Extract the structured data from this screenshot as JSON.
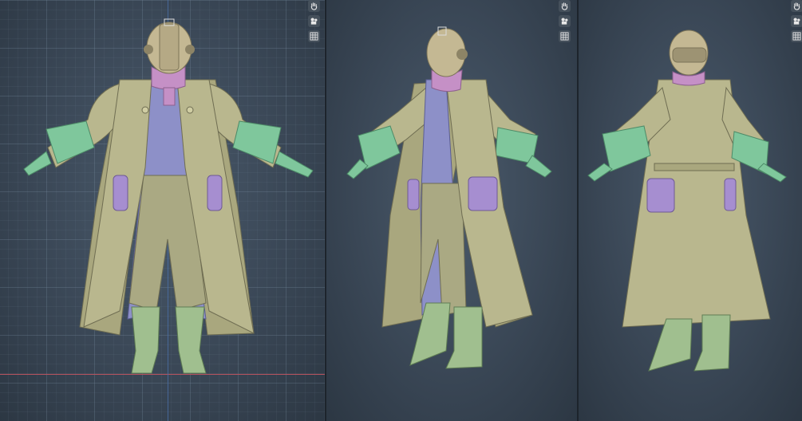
{
  "app": {
    "viewports": [
      {
        "id": "front",
        "tools": [
          "hand-pan-icon",
          "camera-orbit-icon",
          "grid-toggle-icon"
        ]
      },
      {
        "id": "perspective",
        "tools": [
          "hand-pan-icon",
          "camera-orbit-icon",
          "grid-toggle-icon"
        ]
      },
      {
        "id": "back",
        "tools": [
          "hand-pan-icon",
          "camera-orbit-icon",
          "grid-toggle-icon"
        ]
      }
    ]
  },
  "colors": {
    "coat": "#b9b78e",
    "coat_shadow": "#8f8e68",
    "helmet": "#c4b893",
    "vest": "#8d90c8",
    "scarf": "#c590c6",
    "armor_green": "#7fc79c",
    "pouch": "#a68ed0",
    "background": "#3a4756",
    "axis_x": "#b8535f",
    "axis_y": "#4a6fa8"
  }
}
